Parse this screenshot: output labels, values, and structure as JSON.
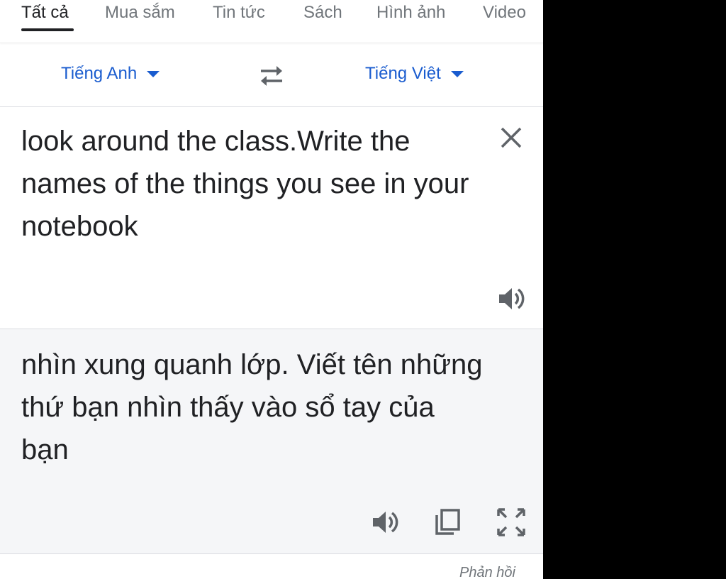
{
  "tabs": [
    {
      "label": "Tất cả",
      "active": true
    },
    {
      "label": "Mua sắm",
      "active": false
    },
    {
      "label": "Tin tức",
      "active": false
    },
    {
      "label": "Sách",
      "active": false
    },
    {
      "label": "Hình ảnh",
      "active": false
    },
    {
      "label": "Video",
      "active": false
    }
  ],
  "translator": {
    "source_language": "Tiếng Anh",
    "target_language": "Tiếng Việt",
    "source_text": "look around the class.Write the names of the things you see in your notebook",
    "translated_text": "nhìn xung quanh lớp. Viết tên những thứ bạn nhìn thấy vào sổ tay của bạn",
    "feedback_label": "Phản hồi"
  },
  "icons": {
    "swap": "swap-languages-icon",
    "clear": "close-icon",
    "listen_source": "speaker-icon",
    "listen_translation": "speaker-icon",
    "copy": "copy-icon",
    "fullscreen": "fullscreen-icon"
  },
  "colors": {
    "accent": "#1a5ccf",
    "text": "#202124",
    "muted": "#70757a",
    "icon": "#5f6368",
    "result_background": "#f5f6f8",
    "outside_background": "#000000"
  }
}
